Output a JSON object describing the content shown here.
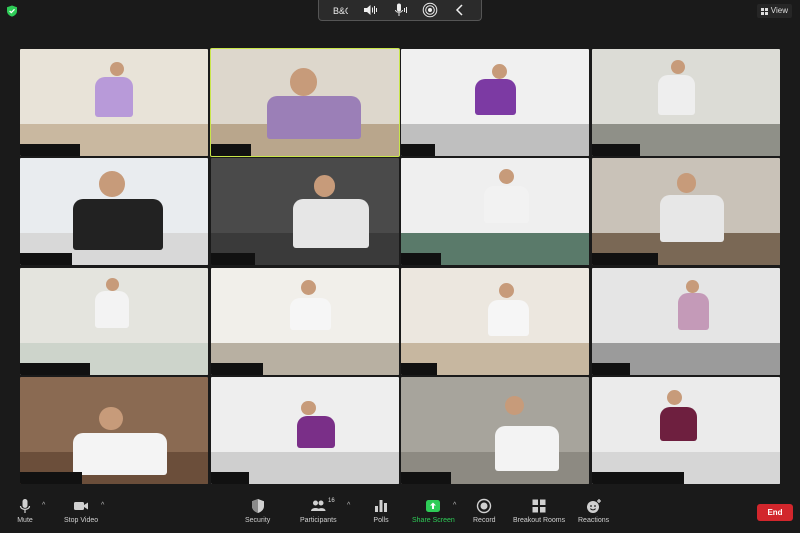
{
  "top_bar": {
    "security_icon": "shield-check-icon",
    "view_label": "View",
    "audio_controls": [
      {
        "name": "bo-brand-icon"
      },
      {
        "name": "speaker-volume-icon"
      },
      {
        "name": "microphone-level-icon"
      },
      {
        "name": "broadcast-icon"
      },
      {
        "name": "chevron-left-icon"
      }
    ],
    "bo_logo_text": "B&O"
  },
  "colors": {
    "background": "#1a1a1a",
    "active_speaker_border": "#c9e64a",
    "share_screen": "#2ecc57",
    "end_button": "#d2262c"
  },
  "video_tiles": [
    {
      "name": "tile-1",
      "wall": "#e8e3d8",
      "floor": "#c9b8a0",
      "shirt": "#b89ad9",
      "active": false
    },
    {
      "name": "tile-2",
      "wall": "#ddd7cc",
      "floor": "#b9a68c",
      "shirt": "#9b7fb7",
      "active": true
    },
    {
      "name": "tile-3",
      "wall": "#f0f0f0",
      "floor": "#bfbfbf",
      "shirt": "#7c3aa3",
      "active": false
    },
    {
      "name": "tile-4",
      "wall": "#dcdcd6",
      "floor": "#8f9088",
      "shirt": "#eeeeee",
      "active": false
    },
    {
      "name": "tile-5",
      "wall": "#e9ecef",
      "floor": "#d8d8d8",
      "shirt": "#222222",
      "active": false
    },
    {
      "name": "tile-6",
      "wall": "#4a4a4a",
      "floor": "#3a3a3a",
      "shirt": "#e6e6e6",
      "active": false
    },
    {
      "name": "tile-7",
      "wall": "#efefef",
      "floor": "#5a7a6a",
      "shirt": "#f2f2f2",
      "active": false
    },
    {
      "name": "tile-8",
      "wall": "#c9c2b8",
      "floor": "#7a6855",
      "shirt": "#e7e7e7",
      "active": false
    },
    {
      "name": "tile-9",
      "wall": "#e4e4de",
      "floor": "#cdd4cb",
      "shirt": "#f3f3f3",
      "active": false
    },
    {
      "name": "tile-10",
      "wall": "#f1efea",
      "floor": "#b8b0a2",
      "shirt": "#f6f6f6",
      "active": false
    },
    {
      "name": "tile-11",
      "wall": "#ece7df",
      "floor": "#c7b7a0",
      "shirt": "#f6f6f6",
      "active": false
    },
    {
      "name": "tile-12",
      "wall": "#e5e5e5",
      "floor": "#9b9b9b",
      "shirt": "#c49ab8",
      "active": false
    },
    {
      "name": "tile-13",
      "wall": "#8a6a52",
      "floor": "#6b4e3a",
      "shirt": "#f4f4f4",
      "active": false
    },
    {
      "name": "tile-14",
      "wall": "#eeeeee",
      "floor": "#cfcfcf",
      "shirt": "#7a2f88",
      "active": false
    },
    {
      "name": "tile-15",
      "wall": "#a7a49c",
      "floor": "#8d8a82",
      "shirt": "#f3f3f3",
      "active": false
    },
    {
      "name": "tile-16",
      "wall": "#ebebeb",
      "floor": "#d6d6d6",
      "shirt": "#6e1f3f",
      "active": false
    }
  ],
  "toolbar": {
    "mute": {
      "label": "Mute",
      "icon": "microphone-icon"
    },
    "stop_video": {
      "label": "Stop Video",
      "icon": "video-camera-icon"
    },
    "security": {
      "label": "Security",
      "icon": "shield-icon"
    },
    "participants": {
      "label": "Participants",
      "icon": "people-icon",
      "count": "16"
    },
    "polls": {
      "label": "Polls",
      "icon": "bar-chart-icon"
    },
    "share_screen": {
      "label": "Share Screen",
      "icon": "share-up-arrow-icon"
    },
    "record": {
      "label": "Record",
      "icon": "record-circle-icon"
    },
    "breakout_rooms": {
      "label": "Breakout Rooms",
      "icon": "grid-squares-icon"
    },
    "reactions": {
      "label": "Reactions",
      "icon": "smiley-plus-icon"
    },
    "end": {
      "label": "End"
    }
  }
}
